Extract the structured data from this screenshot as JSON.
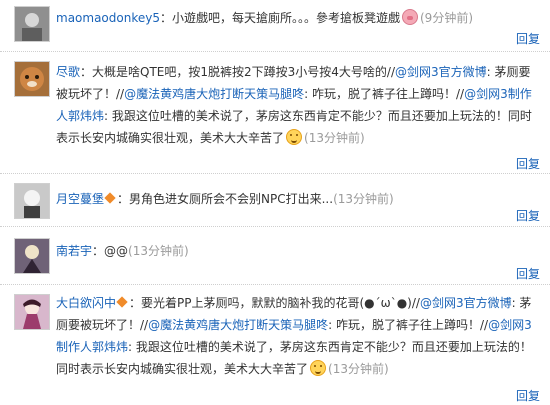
{
  "comments": [
    {
      "user": "maomaodonkey5",
      "text": "：小遊戲吧，每天搶廁所。。。參考搶板凳遊戲",
      "time": "(9分钟前)",
      "reply": "回复"
    },
    {
      "user": "尽歌",
      "text1": "：大概是啥QTE吧，按1脱裤按2下蹲按3小号按4大号啥的//",
      "at1": "@剑网3官方微博",
      "text2": ": 茅厕要被玩坏了！//",
      "at2": "@魔法黄鸡唐大炮打断天策马腿咚",
      "text3": ": 咋玩，脱了裤子往上蹲吗！//",
      "at3": "@剑网3制作人郭炜炜",
      "text4": ": 我跟这位吐槽的美术说了，茅房这东西肯定不能少？而且还要加上玩法的！同时表示长安内城确实很壮观，美术大大辛苦了",
      "time": "(13分钟前)",
      "reply": "回复"
    },
    {
      "user": "月空蔓堡",
      "text": "：男角色进女厕所会不会别NPC打出来...",
      "time": "(13分钟前)",
      "reply": "回复"
    },
    {
      "user": "南若宇",
      "text": "：@@",
      "time": "(13分钟前)",
      "reply": "回复"
    },
    {
      "user": "大白欲闪中",
      "text1": "：要光着PP上茅厕吗，默默的脑补我的花哥(●´ω`●)//",
      "at1": "@剑网3官方微博",
      "text2": ": 茅厕要被玩坏了！//",
      "at2": "@魔法黄鸡唐大炮打断天策马腿咚",
      "text3": ": 咋玩，脱了裤子往上蹲吗！//",
      "at3": "@剑网3制作人郭炜炜",
      "text4": ": 我跟这位吐槽的美术说了，茅房这东西肯定不能少？而且还要加上玩法的！同时表示长安内城确实很壮观，美术大大辛苦了",
      "time": "(13分钟前)",
      "reply": "回复"
    }
  ]
}
